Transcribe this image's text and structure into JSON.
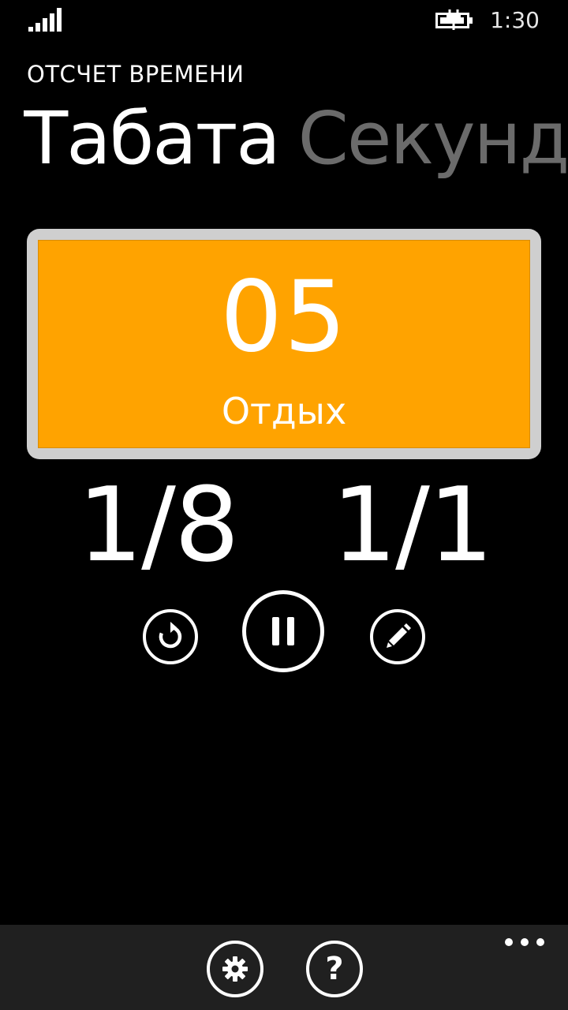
{
  "status_bar": {
    "time": "1:30",
    "signal_icon": "signal-strength-icon",
    "battery_icon": "battery-charging-icon"
  },
  "header": {
    "app_title": "ОТСЧЕТ ВРЕМЕНИ"
  },
  "pivot": {
    "items": [
      {
        "label": "Табата",
        "active": true
      },
      {
        "label": "Секундомер",
        "active": false
      }
    ]
  },
  "timer": {
    "count": "05",
    "phase": "Отдых",
    "panel_color": "#ffa300",
    "frame_color": "#cfcfcf"
  },
  "counters": {
    "rounds": "1/8",
    "cycles": "1/1"
  },
  "controls": {
    "restart_icon": "restart-icon",
    "pause_icon": "pause-icon",
    "edit_icon": "pencil-icon"
  },
  "app_bar": {
    "settings_icon": "gear-icon",
    "help_icon": "question-icon",
    "help_glyph": "?",
    "more_icon": "ellipsis-icon",
    "background": "#202020"
  }
}
